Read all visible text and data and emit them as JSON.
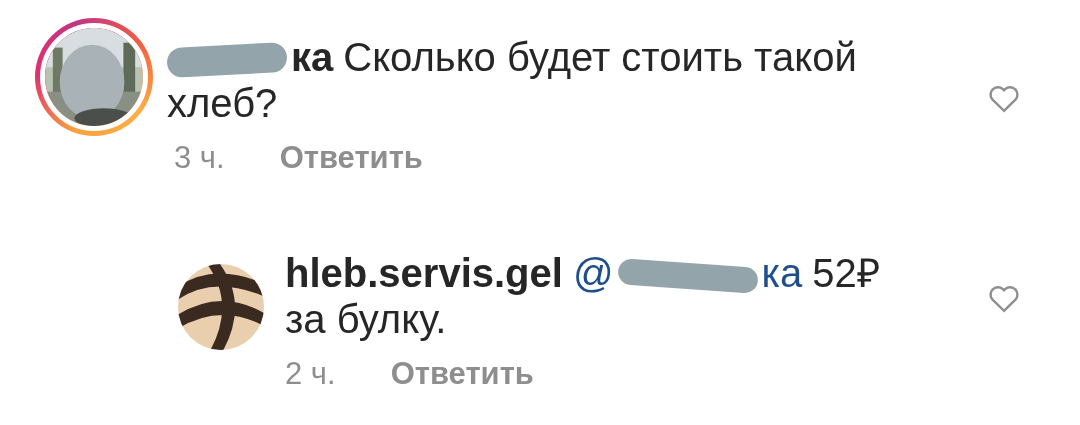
{
  "comments": [
    {
      "author_visible": "ка",
      "text": "Сколько будет стоить такой хлеб?",
      "time": "3 ч.",
      "reply_label": "Ответить",
      "liked": false,
      "story_ring": true,
      "replies": [
        {
          "author": "hleb.servis.gel",
          "mention_start": "@",
          "mention_end": "ка",
          "text": "52₽ за булку.",
          "time": "2 ч.",
          "reply_label": "Ответить",
          "liked": false,
          "story_ring": false,
          "avatar": {
            "kind": "logo"
          }
        }
      ]
    }
  ]
}
